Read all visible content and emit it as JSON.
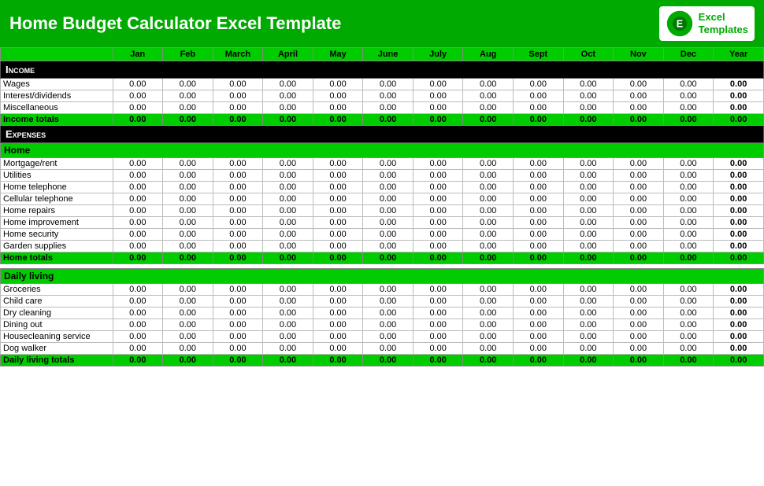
{
  "header": {
    "title": "Home Budget Calculator Excel Template",
    "logo_line1": "Excel",
    "logo_line2": "Templates"
  },
  "columns": {
    "months": [
      "Jan",
      "Feb",
      "March",
      "April",
      "May",
      "June",
      "July",
      "Aug",
      "Sept",
      "Oct",
      "Nov",
      "Dec",
      "Year"
    ]
  },
  "sections": {
    "income": {
      "label": "Income",
      "rows": [
        {
          "label": "Wages"
        },
        {
          "label": "Interest/dividends"
        },
        {
          "label": "Miscellaneous"
        }
      ],
      "totals_label": "Income totals"
    },
    "expenses": {
      "label": "Expenses",
      "subsections": [
        {
          "label": "Home",
          "rows": [
            {
              "label": "Mortgage/rent"
            },
            {
              "label": "Utilities"
            },
            {
              "label": "Home telephone"
            },
            {
              "label": "Cellular telephone"
            },
            {
              "label": "Home repairs"
            },
            {
              "label": "Home improvement"
            },
            {
              "label": "Home security"
            },
            {
              "label": "Garden supplies"
            }
          ],
          "totals_label": "Home totals"
        },
        {
          "label": "Daily living",
          "rows": [
            {
              "label": "Groceries"
            },
            {
              "label": "Child care"
            },
            {
              "label": "Dry cleaning"
            },
            {
              "label": "Dining out"
            },
            {
              "label": "Housecleaning service"
            },
            {
              "label": "Dog walker"
            }
          ],
          "totals_label": "Daily living totals"
        }
      ]
    }
  },
  "zero": "0.00",
  "zero_bold": "0.00"
}
